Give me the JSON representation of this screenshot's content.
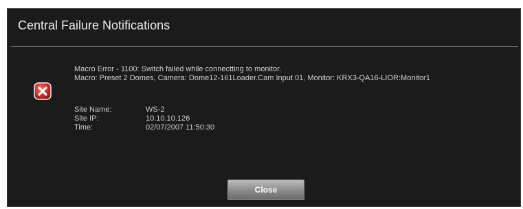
{
  "dialog": {
    "title": "Central Failure Notifications",
    "icon": "error-x-icon",
    "error_color": "#d42a2a",
    "message_line1": "Macro Error - 1100: Switch failed while connectting to monitor.",
    "message_line2": "Macro: Preset 2 Domes, Camera: Dome12-161Loader.Cam Input 01, Monitor: KRX3-QA16-LIOR:Monitor1",
    "details": {
      "site_name_label": "Site Name:",
      "site_name_value": "WS-2",
      "site_ip_label": "Site IP:",
      "site_ip_value": "10.10.10.126",
      "time_label": "Time:",
      "time_value": "02/07/2007  11:50:30"
    },
    "close_label": "Close"
  }
}
